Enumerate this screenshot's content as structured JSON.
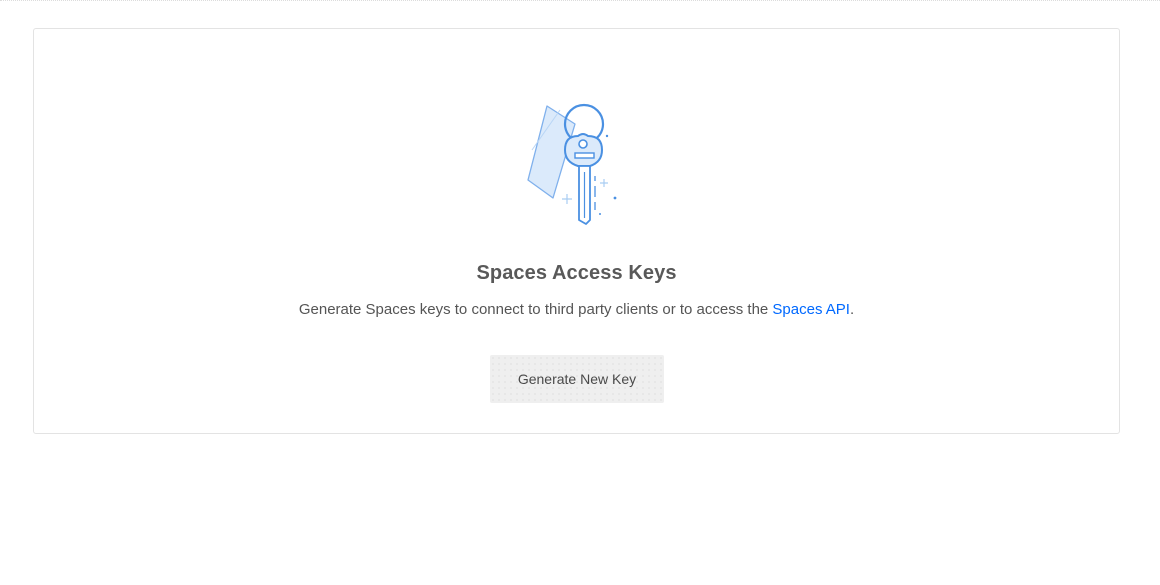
{
  "empty_state": {
    "illustration_icon": "key-keychain-icon",
    "title": "Spaces Access Keys",
    "description_prefix": "Generate Spaces keys to connect to third party clients or to access the ",
    "description_link": "Spaces API",
    "description_suffix": ".",
    "primary_button_label": "Generate New Key"
  },
  "colors": {
    "link": "#0069ff",
    "illustration_blue": "#4a90e2",
    "illustration_fill": "#dbeafb",
    "title_text": "#595959",
    "button_bg": "#efefef"
  }
}
